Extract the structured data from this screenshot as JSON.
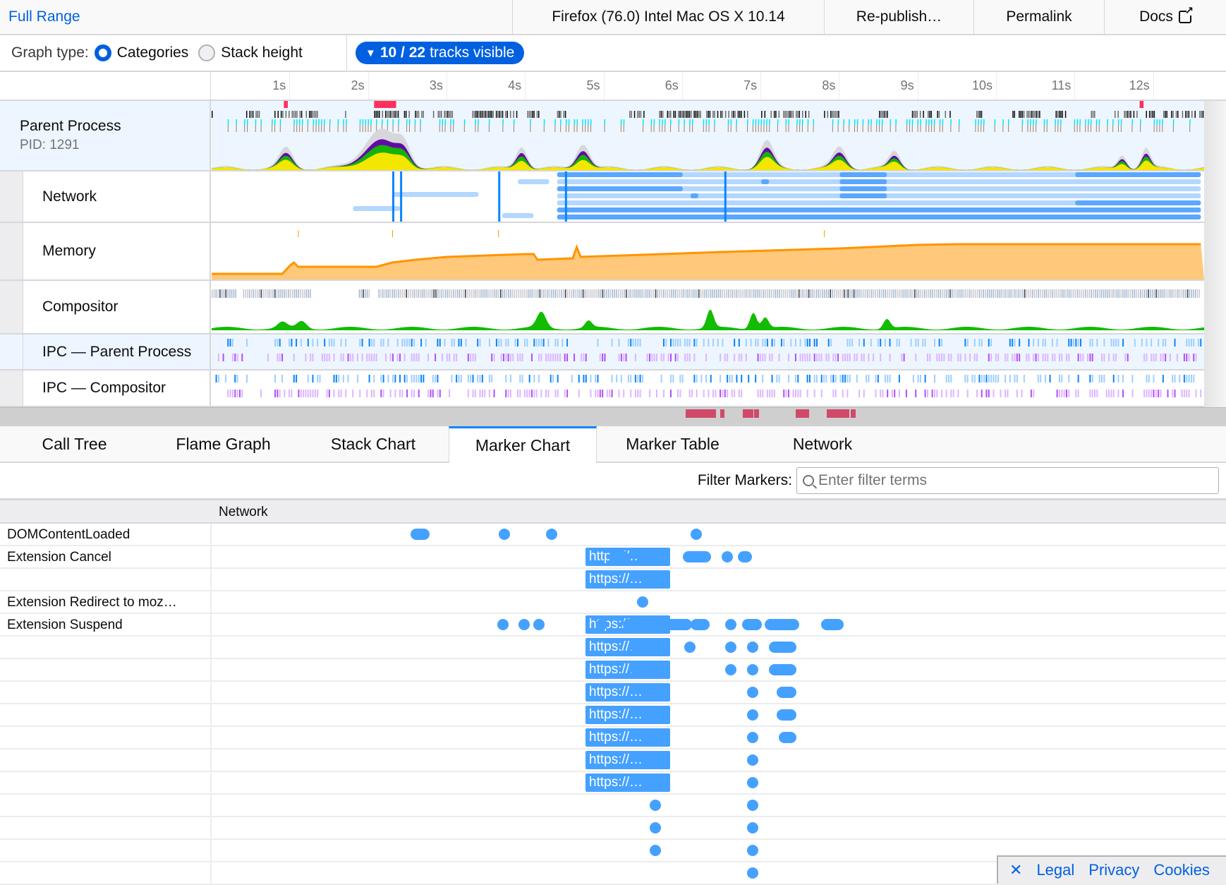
{
  "topbar": {
    "breadcrumb": "Full Range",
    "platform": "Firefox (76.0) Intel Mac OS X 10.14",
    "republish": "Re-publish…",
    "permalink": "Permalink",
    "docs": "Docs",
    "docs_icon": "external-link-icon"
  },
  "toolbar": {
    "graph_type_label": "Graph type:",
    "options": [
      {
        "label": "Categories",
        "selected": true
      },
      {
        "label": "Stack height",
        "selected": false
      }
    ],
    "tracks_visible": "10 / 22",
    "tracks_visible_suffix": "tracks visible",
    "tracks_icon": "triangle-down-icon"
  },
  "timeline": {
    "ticks": [
      "1s",
      "2s",
      "3s",
      "4s",
      "5s",
      "6s",
      "7s",
      "8s",
      "9s",
      "10s",
      "11s",
      "12s"
    ],
    "tracks": [
      {
        "name": "Parent Process",
        "sub": "PID: 1291",
        "selected": true,
        "type": "process"
      },
      {
        "name": "Network",
        "type": "network"
      },
      {
        "name": "Memory",
        "type": "memory"
      },
      {
        "name": "Compositor",
        "type": "thread"
      },
      {
        "name": "IPC — Parent Process",
        "selected": true,
        "type": "ipc"
      },
      {
        "name": "IPC — Compositor",
        "type": "ipc"
      }
    ],
    "colors": {
      "selected_bg": "#edf6ff",
      "network_dark": "#0a84ff",
      "network_light": "#b3d7ff",
      "memory_line": "#ff9400",
      "memory_fill": "#ffc87a",
      "js_yellow": "#ffe900",
      "layout_purple": "#5c00a3",
      "graphics_green": "#12bc00",
      "dom_blue": "#0a84ff",
      "idle_gray": "#d7d7db",
      "screenshot_red": "#ff2f5b",
      "ipc_blue": "#0a84ff",
      "ipc_purple": "#b44cff"
    }
  },
  "tabs": [
    {
      "label": "Call Tree",
      "active": false
    },
    {
      "label": "Flame Graph",
      "active": false
    },
    {
      "label": "Stack Chart",
      "active": false
    },
    {
      "label": "Marker Chart",
      "active": true
    },
    {
      "label": "Marker Table",
      "active": false
    },
    {
      "label": "Network",
      "active": false
    }
  ],
  "filter": {
    "label": "Filter Markers:",
    "placeholder": "Enter filter terms",
    "value": ""
  },
  "marker_chart": {
    "header": "Network",
    "box_label": "https://…",
    "rows": [
      {
        "label": "DOMContentLoaded",
        "dots": [
          [
            3.35,
            3.48
          ],
          [
            4.75
          ],
          [
            5.5
          ],
          [
            7.8
          ]
        ]
      },
      {
        "label": "Extension Cancel",
        "box": true,
        "dots": [
          [
            6.5,
            6.65
          ],
          [
            6.95
          ],
          [
            7.68,
            7.95
          ],
          [
            8.3
          ],
          [
            8.55,
            8.6
          ]
        ]
      },
      {
        "label": "",
        "box": true,
        "dots": []
      },
      {
        "label": "Extension Redirect to moz…",
        "dots": [
          [
            6.95
          ]
        ]
      },
      {
        "label": "Extension Suspend",
        "box": true,
        "pre_dots": [
          [
            4.73
          ],
          [
            5.07
          ],
          [
            5.3
          ]
        ],
        "dots": [
          [
            6.3
          ],
          [
            6.72,
            7.65
          ],
          [
            7.8,
            7.92
          ],
          [
            8.35
          ],
          [
            8.62,
            8.75
          ],
          [
            8.98,
            9.35
          ],
          [
            9.88,
            10.05
          ]
        ]
      },
      {
        "label": "",
        "box": true,
        "dots": [
          [
            6.85,
            6.95
          ],
          [
            7.15
          ],
          [
            7.7
          ],
          [
            8.35
          ],
          [
            8.7
          ],
          [
            9.05,
            9.3
          ]
        ]
      },
      {
        "label": "",
        "box": true,
        "dots": [
          [
            6.85,
            6.95
          ],
          [
            7.15
          ],
          [
            8.35
          ],
          [
            8.7
          ],
          [
            9.05,
            9.3
          ]
        ]
      },
      {
        "label": "",
        "box": true,
        "dots": [
          [
            7.15
          ],
          [
            8.7
          ],
          [
            9.17,
            9.3
          ]
        ]
      },
      {
        "label": "",
        "box": true,
        "dots": [
          [
            7.15
          ],
          [
            8.7
          ],
          [
            9.17,
            9.3
          ]
        ]
      },
      {
        "label": "",
        "box": true,
        "dots": [
          [
            7.15
          ],
          [
            8.7
          ],
          [
            9.2,
            9.3
          ]
        ]
      },
      {
        "label": "",
        "box": true,
        "dots": [
          [
            7.15
          ],
          [
            8.7
          ]
        ]
      },
      {
        "label": "",
        "box": true,
        "dots": [
          [
            7.15
          ],
          [
            8.7
          ]
        ]
      },
      {
        "label": "",
        "dots": [
          [
            7.15
          ],
          [
            8.7
          ]
        ]
      },
      {
        "label": "",
        "dots": [
          [
            7.15
          ],
          [
            8.7
          ]
        ]
      },
      {
        "label": "",
        "dots": [
          [
            7.15
          ],
          [
            8.7
          ]
        ]
      },
      {
        "label": "",
        "dots": [
          [
            8.7
          ]
        ]
      }
    ]
  },
  "footer": {
    "close_icon": "close-icon",
    "links": [
      "Legal",
      "Privacy",
      "Cookies"
    ]
  }
}
